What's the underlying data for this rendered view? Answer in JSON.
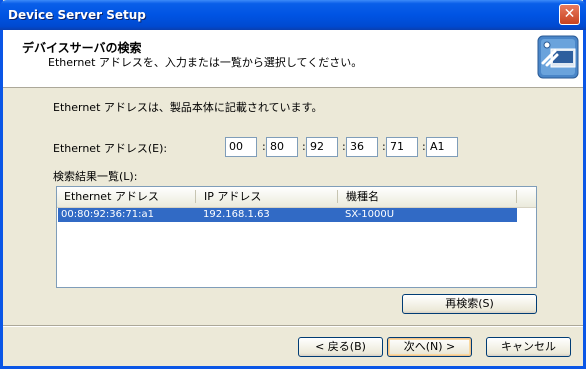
{
  "window": {
    "title": "Device Server Setup",
    "close_label": "✕"
  },
  "header": {
    "title": "デバイスサーバの検索",
    "subtitle": "Ethernet アドレスを、入力または一覧から選択してください。"
  },
  "body": {
    "info_text": "Ethernet アドレスは、製品本体に記載されています。",
    "mac_label": "Ethernet アドレス(E):",
    "mac_octets": [
      "00",
      "80",
      "92",
      "36",
      "71",
      "A1"
    ],
    "separator": ":",
    "list_label": "検索結果一覧(L):"
  },
  "list": {
    "columns": [
      "Ethernet アドレス",
      "IP アドレス",
      "機種名"
    ],
    "rows": [
      {
        "mac": "00:80:92:36:71:a1",
        "ip": "192.168.1.63",
        "model": "SX-1000U"
      }
    ]
  },
  "buttons": {
    "research": "再検索(S)",
    "back": "< 戻る(B)",
    "next": "次へ(N) >",
    "cancel": "キャンセル"
  },
  "colors": {
    "titlebar": "#0054e3",
    "selection": "#316ac5",
    "face": "#ece9d8"
  }
}
